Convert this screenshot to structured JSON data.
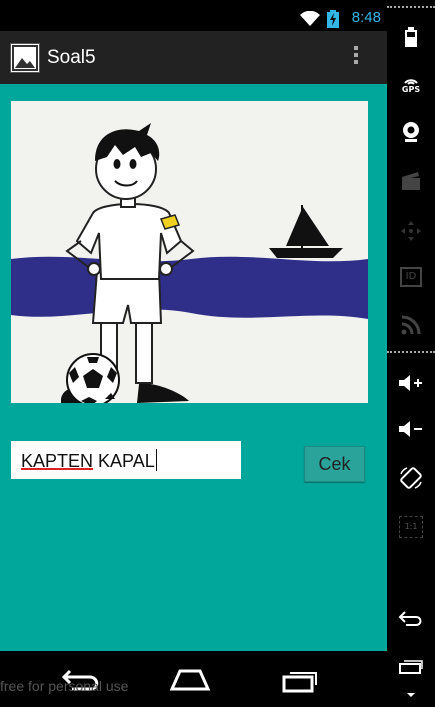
{
  "status_bar": {
    "time": "8:48"
  },
  "action_bar": {
    "title": "Soal5"
  },
  "answer": {
    "word1": "KAPTEN",
    "word2": "KAPAL"
  },
  "cek_button": {
    "label": "Cek"
  },
  "watermark": "free for personal use",
  "side_panel": {
    "gps_label": "GPS",
    "id_label": "ID",
    "zoom_label": "1:1"
  }
}
